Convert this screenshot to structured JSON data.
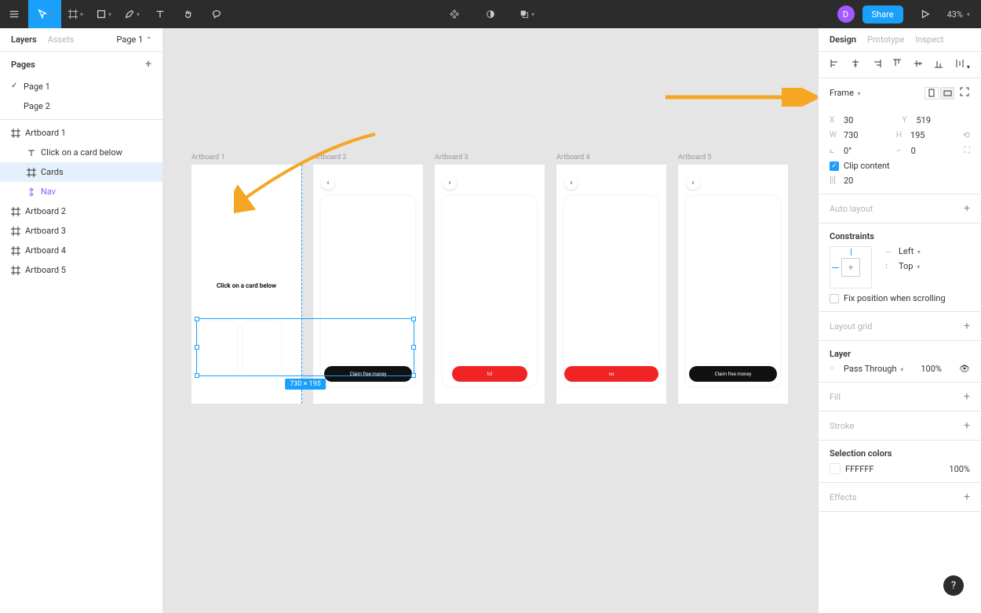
{
  "toolbar": {
    "zoom": "43%",
    "share_label": "Share",
    "avatar_initial": "D"
  },
  "left_panel": {
    "tabs": {
      "layers": "Layers",
      "assets": "Assets"
    },
    "page_selector": "Page 1",
    "pages_header": "Pages",
    "pages": [
      "Page 1",
      "Page 2"
    ],
    "layers": {
      "artboard1": "Artboard 1",
      "click_text": "Click on a card below",
      "cards": "Cards",
      "nav": "Nav",
      "artboard2": "Artboard 2",
      "artboard3": "Artboard 3",
      "artboard4": "Artboard 4",
      "artboard5": "Artboard 5"
    }
  },
  "canvas": {
    "artboards": {
      "ab1": "Artboard 1",
      "ab2": "Artboard 2",
      "ab3": "Artboard 3",
      "ab4": "Artboard 4",
      "ab5": "Artboard 5"
    },
    "click_below": "Click on a card below",
    "buttons": {
      "claim": "Claim free money",
      "lol": "lol",
      "no": "no"
    },
    "selection_dims": "730 × 195"
  },
  "right_panel": {
    "tabs": {
      "design": "Design",
      "prototype": "Prototype",
      "inspect": "Inspect"
    },
    "frame_label": "Frame",
    "x": "30",
    "y": "519",
    "w": "730",
    "h": "195",
    "rot": "0°",
    "rad": "0",
    "clip_content": "Clip content",
    "item_spacing": "20",
    "auto_layout": "Auto layout",
    "constraints": "Constraints",
    "constraint_h": "Left",
    "constraint_v": "Top",
    "fix_position": "Fix position when scrolling",
    "layout_grid": "Layout grid",
    "layer": "Layer",
    "blend_mode": "Pass Through",
    "opacity": "100%",
    "fill": "Fill",
    "stroke": "Stroke",
    "selection_colors": "Selection colors",
    "color_hex": "FFFFFF",
    "color_pct": "100%",
    "effects": "Effects"
  },
  "help": "?"
}
